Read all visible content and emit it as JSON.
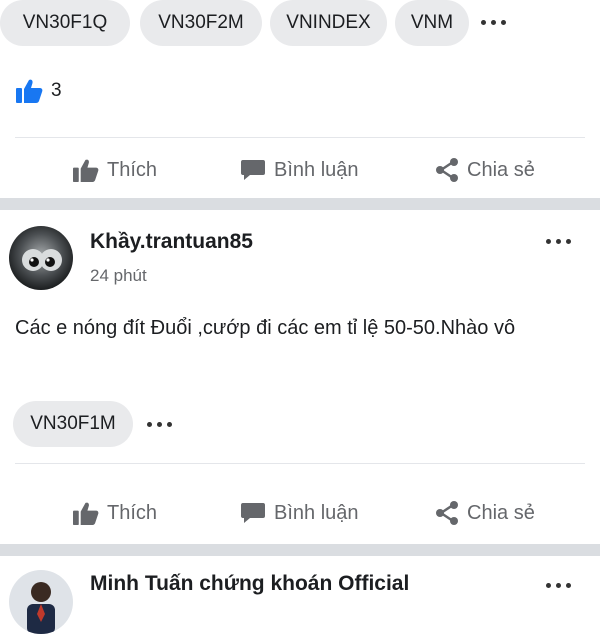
{
  "post1": {
    "tags": [
      "VN30F1Q",
      "VN30F2M",
      "VNINDEX",
      "VNM"
    ],
    "like_count": "3",
    "actions": {
      "like": "Thích",
      "comment": "Bình luận",
      "share": "Chia sẻ"
    }
  },
  "post2": {
    "author": "Khầy.trantuan85",
    "time": "24 phút",
    "text": "Các e nóng đít Đuổi ,cướp đi các em tỉ lệ 50-50.Nhào vô",
    "tags": [
      "VN30F1M"
    ],
    "actions": {
      "like": "Thích",
      "comment": "Bình luận",
      "share": "Chia sẻ"
    }
  },
  "post3": {
    "author": "Minh Tuấn chứng khoán Official"
  },
  "colors": {
    "like_blue": "#1877f2",
    "gray_icon": "#65676b",
    "chip_bg": "#e9eaec",
    "separator": "#dadde1"
  },
  "icons": [
    "thumbs-up-icon",
    "comment-icon",
    "share-icon",
    "more-icon"
  ]
}
